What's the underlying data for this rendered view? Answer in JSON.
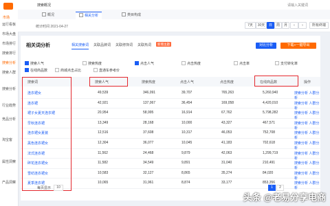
{
  "sidebar": {
    "logo_text": "市场",
    "items": [
      "运行看板",
      "市场大盘",
      "市场排行",
      "搜索排行",
      "搜索分析",
      "搜索人群",
      "搜索分析",
      "行业趋势",
      "竞品分析",
      "淘宝客",
      "属性洞察",
      "产品洞察"
    ]
  },
  "topbar": {
    "title": "搜索概况",
    "right": "请输入关键词"
  },
  "tabs": [
    {
      "label": "概况",
      "active": false
    },
    {
      "label": "相关分析",
      "active": true
    },
    {
      "label": "类目构成",
      "active": false
    }
  ],
  "stat_date": "统计时间 2021-04-27",
  "period_buttons": [
    "7天",
    "30天",
    "日",
    "周",
    "月"
  ],
  "device_select": "所有终端",
  "panel": {
    "title": "相关词分析",
    "tabs": [
      "相关搜索词",
      "关联品牌词",
      "关联修饰词",
      "关联热词"
    ],
    "badge": "新增主题",
    "buttons": [
      "对比分析",
      "下载+一键导出"
    ]
  },
  "metrics_row1": [
    {
      "label": "搜索人气",
      "checked": true
    },
    {
      "label": "搜索热度",
      "checked": false
    },
    {
      "label": "点击人气",
      "checked": true
    },
    {
      "label": "点击热度",
      "checked": false
    },
    {
      "label": "点击率",
      "checked": false
    },
    {
      "label": "支付转化率",
      "checked": false
    }
  ],
  "metrics_row2": [
    {
      "label": "在线商品数",
      "checked": true
    },
    {
      "label": "商城点击占比",
      "checked": false
    },
    {
      "label": "直通车参考价",
      "checked": false
    }
  ],
  "table": {
    "headers": [
      "搜索词",
      "搜索人气",
      "搜索热度",
      "点击人气",
      "点击热度",
      "在线商品数",
      "操作"
    ],
    "rows": [
      [
        "连衣裙女",
        "49,539",
        "346,091",
        "39,707",
        "765,263",
        "5,260,940",
        "搜索分析 人群分析"
      ],
      [
        "连衣裙",
        "42,921",
        "137,067",
        "36,454",
        "169,058",
        "4,420,010",
        "搜索分析 人群分析"
      ],
      [
        "裙子女夏天连衣裙",
        "20,954",
        "58,995",
        "16,914",
        "67,762",
        "5,798,282",
        "搜索分析 人群分析"
      ],
      [
        "早秋连衣裙",
        "13,349",
        "28,168",
        "10,000",
        "43,327",
        "467,571",
        "搜索分析 人群分析"
      ],
      [
        "连衣裙女夏装",
        "12,516",
        "37,608",
        "10,317",
        "46,053",
        "752,708",
        "搜索分析 人群分析"
      ],
      [
        "黑色连衣裙女",
        "12,304",
        "36,077",
        "10,045",
        "41,183",
        "702,618",
        "搜索分析 人群分析"
      ],
      [
        "法式连衣裙",
        "11,562",
        "24,468",
        "9,879",
        "42,063",
        "1,299,719",
        "搜索分析 人群分析"
      ],
      [
        "碎花连衣裙女",
        "11,582",
        "34,549",
        "9,891",
        "31,040",
        "210,491",
        "搜索分析 人群分析"
      ],
      [
        "雪纺连衣裙女",
        "10,583",
        "32,127",
        "8,865",
        "35,274",
        "84,020",
        "搜索分析 人群分析"
      ],
      [
        "夏季连衣裙",
        "10,065",
        "31,961",
        "8,874",
        "33,177",
        "853,356",
        "搜索分析 人群分析"
      ]
    ]
  },
  "pagination": {
    "page_size_label": "每页显示",
    "page_size": "10",
    "pages": [
      "1",
      "2"
    ]
  },
  "watermark": "头条 @老易分享电商"
}
